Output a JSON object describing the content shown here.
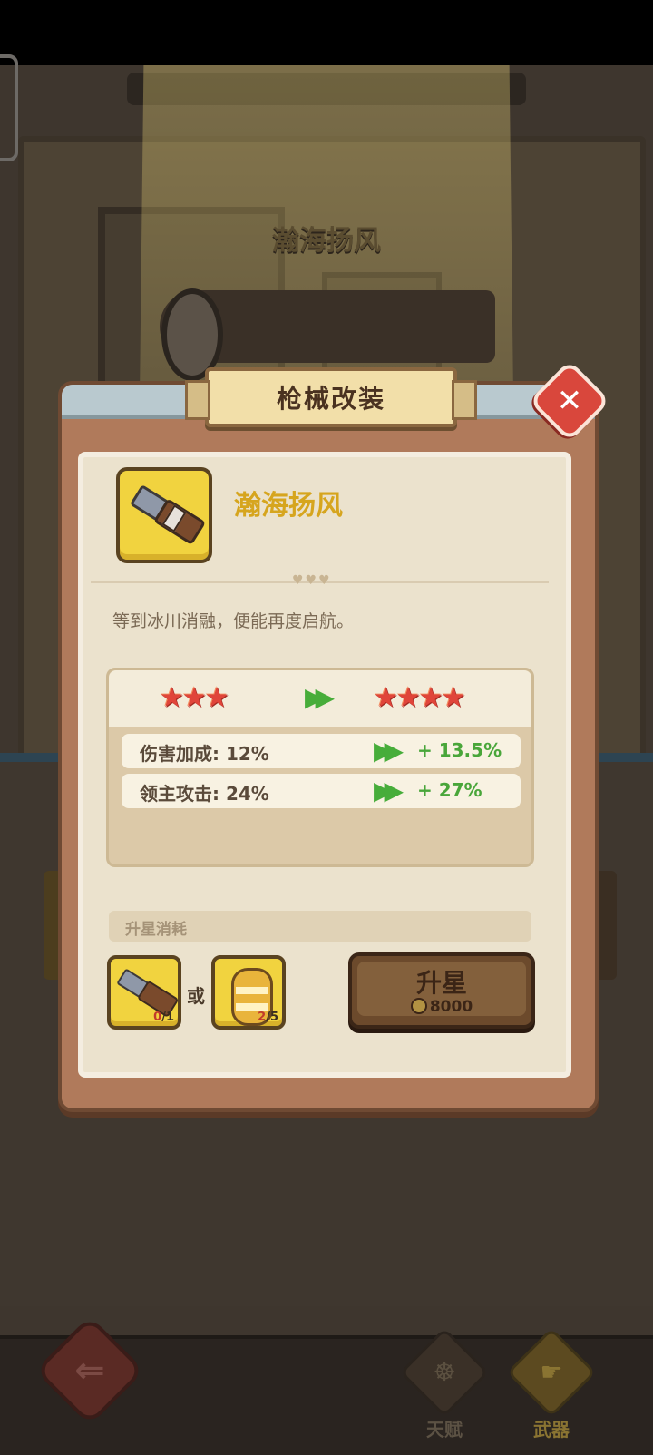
{
  "background": {
    "item_title": "瀚海扬风",
    "nav_tabs": [
      {
        "label": "天赋",
        "icon": "talent-icon"
      },
      {
        "label": "武器",
        "icon": "weapon-icon",
        "active": true
      }
    ]
  },
  "modal": {
    "title": "枪械改装",
    "item": {
      "name": "瀚海扬风",
      "description": "等到冰川消融，便能再度启航。",
      "icon": "flintlock-gun-icon"
    },
    "stars": {
      "from": 3,
      "to": 4,
      "from_display": "★★★",
      "to_display": "★★★★"
    },
    "stats": [
      {
        "label": "伤害加成: 12%",
        "bonus": "+ 13.5%"
      },
      {
        "label": "领主攻击: 24%",
        "bonus": "+ 27%"
      }
    ],
    "cost": {
      "header": "升星消耗",
      "or_text": "或",
      "materials": [
        {
          "icon": "flintlock-gun-icon",
          "have": "0",
          "need": "/1"
        },
        {
          "icon": "golden-barrel-icon",
          "have": "2",
          "need": "/5"
        }
      ]
    },
    "upgrade_button": {
      "label": "升星",
      "cost": "8000",
      "cost_icon": "coin-icon"
    },
    "colors": {
      "title_banner": "#f2dfa9",
      "item_name": "#d6a51e",
      "bonus_green": "#49a63a",
      "star_red": "#e0453a",
      "close_red": "#d9473c"
    }
  }
}
